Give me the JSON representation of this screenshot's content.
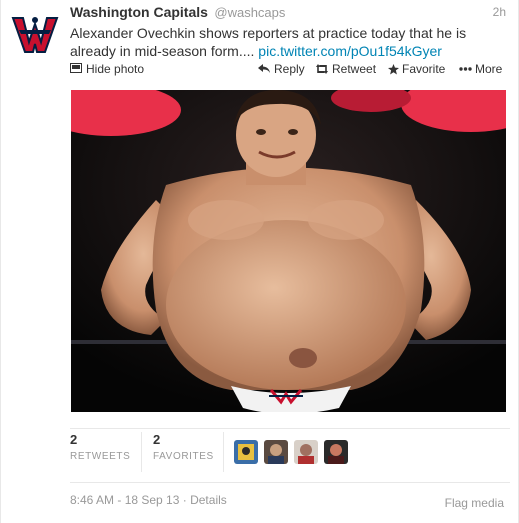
{
  "tweet": {
    "account_name": "Washington Capitals",
    "handle": "@washcaps",
    "time_ago": "2h",
    "text": "Alexander Ovechkin shows reporters at practice today that he is already in mid-season form....",
    "link": "pic.twitter.com/pOu1f54kGyer"
  },
  "actions": {
    "hide_photo": "Hide photo",
    "reply": "Reply",
    "retweet": "Retweet",
    "favorite": "Favorite",
    "more": "More"
  },
  "stats": {
    "retweets_count": "2",
    "retweets_label": "RETWEETS",
    "favorites_count": "2",
    "favorites_label": "FAVORITES"
  },
  "footer": {
    "timestamp": "8:46 AM - 18 Sep 13",
    "details": "Details",
    "flag_media": "Flag media"
  },
  "colors": {
    "link": "#0084b4",
    "text": "#333333",
    "muted": "#999999",
    "brand_red": "#c8102e",
    "brand_navy": "#041e42"
  },
  "icons": [
    "capitals-logo-icon",
    "photo-icon",
    "reply-icon",
    "retweet-icon",
    "favorite-star-icon",
    "more-dots-icon"
  ]
}
